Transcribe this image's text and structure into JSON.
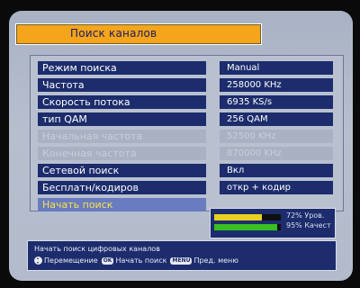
{
  "title": "Поиск каналов",
  "menu": [
    {
      "label": "Режим поиска",
      "value": "Manual",
      "state": "normal"
    },
    {
      "label": "Частота",
      "value": "258000 KHz",
      "state": "normal"
    },
    {
      "label": "Скорость потока",
      "value": "6935 KS/s",
      "state": "normal"
    },
    {
      "label": "тип QAM",
      "value": "256 QAM",
      "state": "normal"
    },
    {
      "label": "Начальная частота",
      "value": "52500 KHz",
      "state": "disabled"
    },
    {
      "label": "Конечная частота",
      "value": "870000 KHz",
      "state": "disabled"
    },
    {
      "label": "Сетевой поиск",
      "value": "Вкл",
      "state": "normal"
    },
    {
      "label": "Бесплатн/кодиров",
      "value": "откр + кодир",
      "state": "normal"
    },
    {
      "label": "Начать поиск",
      "value": "",
      "state": "highlight"
    }
  ],
  "signal": {
    "level_text": "72% Уров.",
    "level_percent": 72,
    "quality_text": "95% Качест",
    "quality_percent": 95
  },
  "help": {
    "description": "Начать поиск цифровых каналов",
    "move_label": "Перемещение",
    "ok_key": "OK",
    "ok_label": "Начать поиск",
    "menu_key": "MENU",
    "menu_label": "Пред. меню"
  },
  "colors": {
    "title_bg": "#f4a51a",
    "row_bg": "#1c2c6c",
    "highlight_bg": "#6a7cc0",
    "highlight_text": "#f6e24a",
    "level_bar": "#e8d020",
    "quality_bar": "#38c020"
  }
}
